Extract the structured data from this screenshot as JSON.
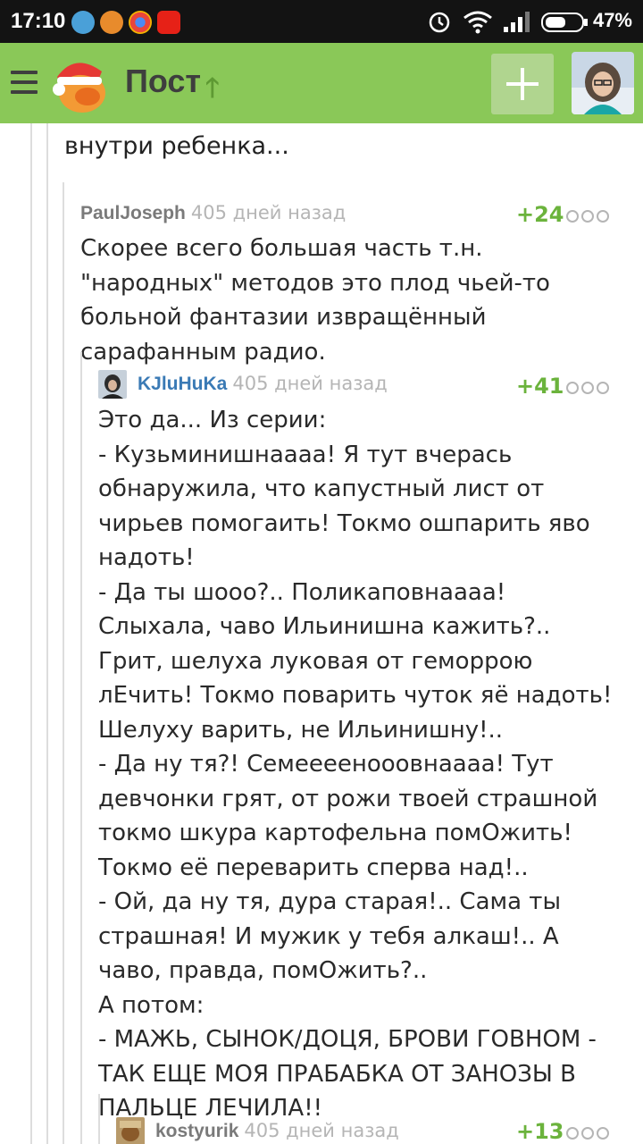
{
  "status_bar": {
    "time": "17:10",
    "battery": "47%"
  },
  "app_bar": {
    "title": "Пост"
  },
  "thread": {
    "parent_tail": "внутри ребенка...",
    "comments": [
      {
        "author": "PaulJoseph",
        "time": "405 дней назад",
        "score": "+24",
        "text": "Скорее всего большая часть т.н. \"народных\" методов это плод чьей-то больной фантазии извращённый сарафанным радио."
      },
      {
        "author": "KJluHuKa",
        "time": "405 дней назад",
        "score": "+41",
        "text": "Это да... Из серии:\n- Кузьминишнаааа! Я тут вчерась обнаружила, что капустный лист от чирьев помогаить! Токмо ошпарить яво надоть!\n- Да ты шооо?.. Поликаповнаааа! Слыхала, чаво Ильинишна кажить?.. Грит, шелуха луковая от геморрою лЕчить! Токмо поварить чуток яё надоть! Шелуху варить, не Ильинишну!..\n- Да ну тя?! Семеееенооовнаааа! Тут девчонки грят, от рожи твоей страшной токмо шкура картофельна помОжить! Токмо её переварить сперва над!..\n- Ой, да ну тя, дура старая!.. Сама ты страшная! И мужик у тебя алкаш!.. А чаво, правда, помОжить?..\nА потом:\n- МАЖЬ, СЫНОК/ДОЦЯ, БРОВИ ГОВНОМ - ТАК ЕЩЕ МОЯ ПРАБАБКА ОТ ЗАНОЗЫ В ПАЛЬЦЕ ЛЕЧИЛА!!"
      },
      {
        "author": "kostyurik",
        "time": "405 дней назад",
        "score": "+13",
        "text": ""
      }
    ]
  },
  "colors": {
    "appbar": "#8ac858",
    "score": "#6bb33c",
    "author_link": "#3a7ab5"
  }
}
